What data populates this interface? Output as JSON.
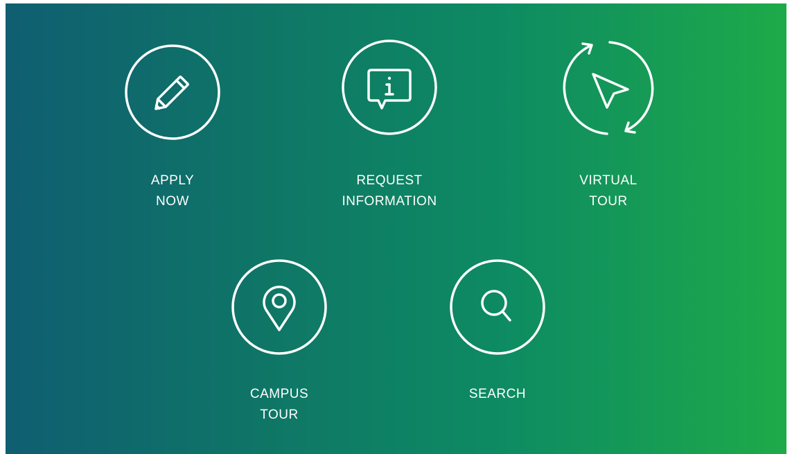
{
  "actions": [
    {
      "id": "apply-now",
      "line1": "APPLY",
      "line2": "NOW",
      "icon": "pencil-icon"
    },
    {
      "id": "request-information",
      "line1": "REQUEST",
      "line2": "INFORMATION",
      "icon": "info-chat-icon"
    },
    {
      "id": "virtual-tour",
      "line1": "VIRTUAL",
      "line2": "TOUR",
      "icon": "cursor-rotate-icon"
    },
    {
      "id": "campus-tour",
      "line1": "CAMPUS",
      "line2": "TOUR",
      "icon": "location-pin-icon"
    },
    {
      "id": "search",
      "line1": "SEARCH",
      "line2": "",
      "icon": "search-icon"
    }
  ],
  "colors": {
    "gradient_start": "#0f5e71",
    "gradient_end": "#1eaa49",
    "foreground": "#ffffff"
  }
}
